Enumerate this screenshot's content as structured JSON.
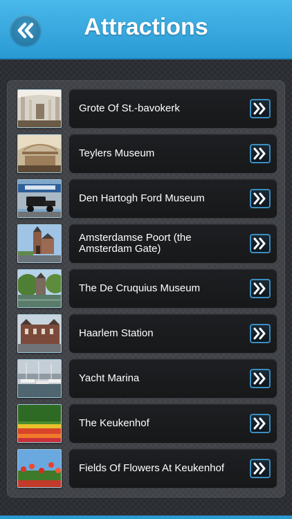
{
  "header": {
    "title": "Attractions",
    "back_icon": "double-chevron-left-icon",
    "color": "#2a9ad4"
  },
  "attractions": [
    {
      "label": "Grote Of St.-bavokerk",
      "thumb": "church-interior"
    },
    {
      "label": "Teylers Museum",
      "thumb": "museum-hall"
    },
    {
      "label": "Den Hartogh Ford Museum",
      "thumb": "vintage-car"
    },
    {
      "label": "Amsterdamse Poort (the Amsterdam Gate)",
      "thumb": "city-gate"
    },
    {
      "label": "The De Cruquius Museum",
      "thumb": "canal-building"
    },
    {
      "label": "Haarlem Station",
      "thumb": "station-building"
    },
    {
      "label": "Yacht Marina",
      "thumb": "marina-boats"
    },
    {
      "label": "The Keukenhof",
      "thumb": "tulip-garden"
    },
    {
      "label": "Fields Of Flowers At Keukenhof",
      "thumb": "tulip-field"
    }
  ],
  "row_action_icon": "double-chevron-right-icon"
}
